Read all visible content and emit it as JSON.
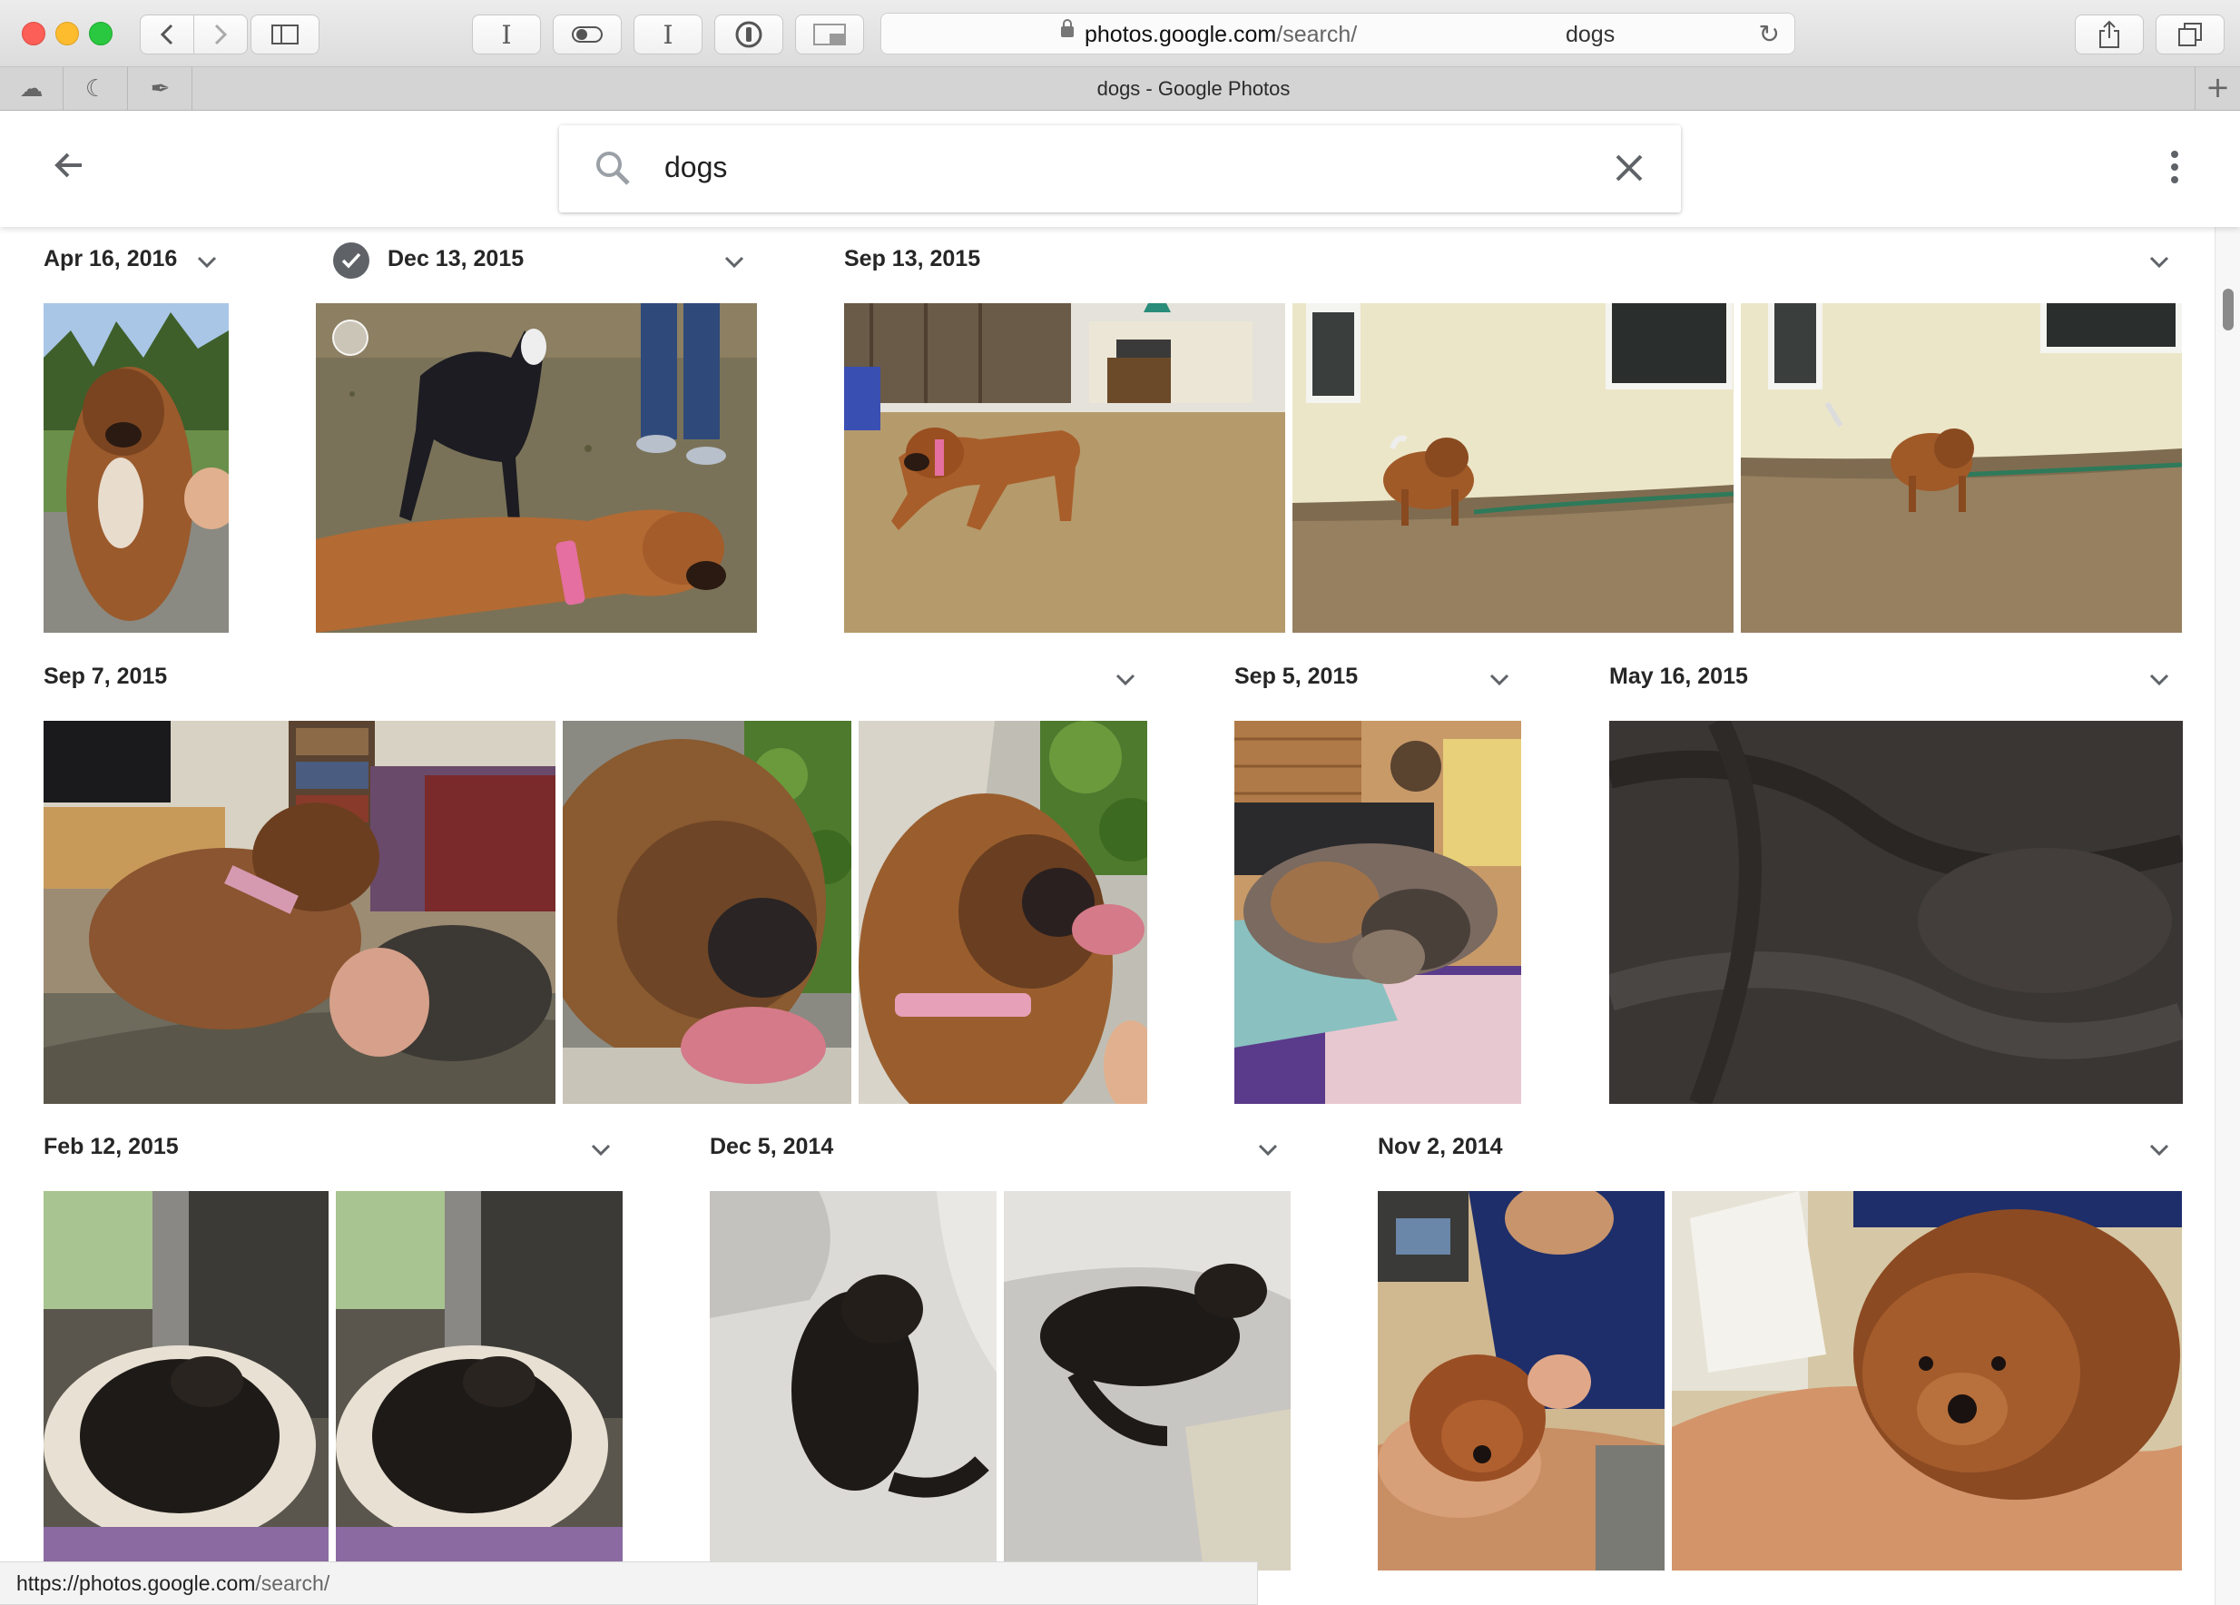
{
  "browser": {
    "address_host": "photos.google.com",
    "address_path": "/search/",
    "address_query": "dogs",
    "tab_title": "dogs - Google Photos",
    "status_url_host": "https://photos.google.com",
    "status_url_path": "/search/"
  },
  "search": {
    "query": "dogs"
  },
  "groups": [
    {
      "date": "Apr 16, 2016",
      "selected": false
    },
    {
      "date": "Dec 13, 2015",
      "selected": true
    },
    {
      "date": "Sep 13, 2015",
      "selected": false
    },
    {
      "date": "Sep 7, 2015",
      "selected": false
    },
    {
      "date": "Sep 5, 2015",
      "selected": false
    },
    {
      "date": "May 16, 2015",
      "selected": false
    },
    {
      "date": "Feb 12, 2015",
      "selected": false
    },
    {
      "date": "Dec 5, 2014",
      "selected": false
    },
    {
      "date": "Nov 2, 2014",
      "selected": false
    }
  ],
  "colors": {
    "accent": "#1a73e8",
    "check_grey": "#5f6368",
    "icon_grey": "#5f6368"
  }
}
